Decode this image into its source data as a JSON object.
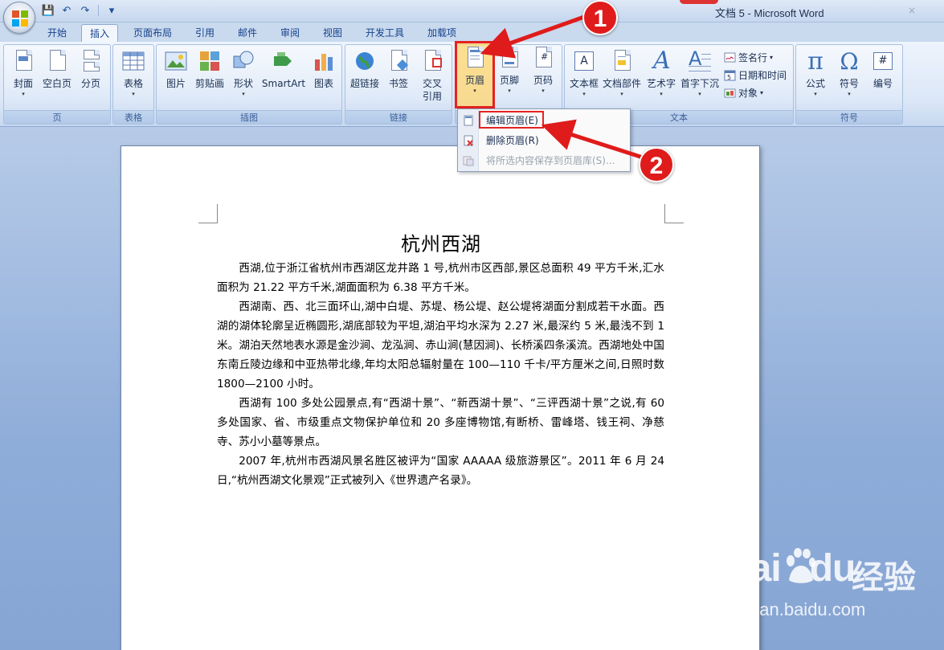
{
  "window": {
    "title": "文档 5 - Microsoft Word",
    "close_fade": "×"
  },
  "quick_access": {
    "save": "💾",
    "undo": "↶",
    "redo": "↷",
    "more": "▾"
  },
  "tabs": [
    "开始",
    "插入",
    "页面布局",
    "引用",
    "邮件",
    "审阅",
    "视图",
    "开发工具",
    "加载项"
  ],
  "active_tab": "插入",
  "ribbon": {
    "groups": {
      "page": "页",
      "table": "表格",
      "illustration": "插图",
      "links": "链接",
      "header_footer": "",
      "text": "文本",
      "symbols": "符号"
    },
    "buttons": {
      "cover": "封面",
      "blank": "空白页",
      "pagebreak": "分页",
      "table": "表格",
      "picture": "图片",
      "clipart": "剪贴画",
      "shapes": "形状",
      "smartart": "SmartArt",
      "chart": "图表",
      "hyperlink": "超链接",
      "bookmark": "书签",
      "crossref": "交叉",
      "crossref2": "引用",
      "header": "页眉",
      "footer": "页脚",
      "pagenum": "页码",
      "textbox": "文本框",
      "quickparts": "文档部件",
      "wordart": "艺术字",
      "dropcap": "首字下沉",
      "signature": "签名行",
      "datetime": "日期和时间",
      "object": "对象",
      "equation": "公式",
      "symbol": "符号",
      "number": "编号"
    },
    "icons": {
      "pi": "π",
      "omega": "Ω",
      "hash": "#",
      "wordart_a": "A"
    }
  },
  "header_menu": {
    "items": [
      {
        "label": "编辑页眉(E)",
        "enabled": true
      },
      {
        "label": "删除页眉(R)",
        "enabled": true
      },
      {
        "label": "将所选内容保存到页眉库(S)...",
        "enabled": false
      }
    ]
  },
  "annotations": {
    "step1": "1",
    "step2": "2"
  },
  "document": {
    "title": "杭州西湖",
    "paragraphs": [
      "西湖,位于浙江省杭州市西湖区龙井路 1 号,杭州市区西部,景区总面积 49 平方千米,汇水面积为 21.22 平方千米,湖面面积为 6.38 平方千米。",
      "西湖南、西、北三面环山,湖中白堤、苏堤、杨公堤、赵公堤将湖面分割成若干水面。西湖的湖体轮廓呈近椭圆形,湖底部较为平坦,湖泊平均水深为 2.27 米,最深约 5 米,最浅不到 1 米。湖泊天然地表水源是金沙涧、龙泓涧、赤山涧(慧因涧)、长桥溪四条溪流。西湖地处中国东南丘陵边缘和中亚热带北缘,年均太阳总辐射量在 100—110 千卡/平方厘米之间,日照时数 1800—2100 小时。",
      "西湖有 100 多处公园景点,有“西湖十景”、“新西湖十景”、“三评西湖十景”之说,有 60 多处国家、省、市级重点文物保护单位和 20 多座博物馆,有断桥、雷峰塔、钱王祠、净慈寺、苏小小墓等景点。",
      "2007 年,杭州市西湖风景名胜区被评为“国家 AAAAA 级旅游景区”。2011 年 6 月 24 日,“杭州西湖文化景观”正式被列入《世界遗产名录》。"
    ]
  },
  "watermark": {
    "brand": "Bai",
    "brand2": "du",
    "cn": "经验",
    "url": "jingyan.baidu.com"
  }
}
